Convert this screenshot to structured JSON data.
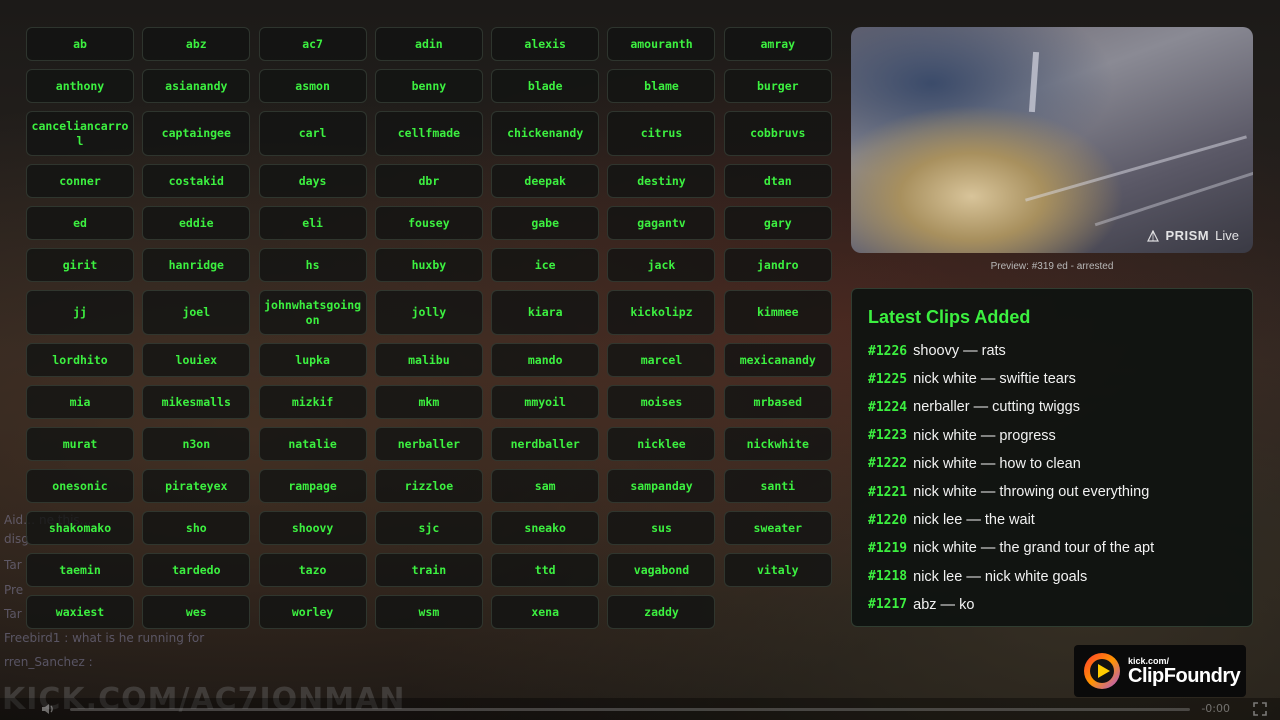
{
  "background_stream": {
    "chat_lines": [
      "Aid…          ne                    this…",
      "disg",
      "Tar",
      "Pre",
      "Tar",
      "Freebird1 : what is he running for",
      "rren_Sanchez :"
    ],
    "brand_text": "KICK.COM/AC7IONMAN",
    "time_label": "-0:00"
  },
  "streamers": [
    "ab",
    "abz",
    "ac7",
    "adin",
    "alexis",
    "amouranth",
    "amray",
    "anthony",
    "asianandy",
    "asmon",
    "benny",
    "blade",
    "blame",
    "burger",
    "canceliancarrol",
    "captaingee",
    "carl",
    "cellfmade",
    "chickenandy",
    "citrus",
    "cobbruvs",
    "conner",
    "costakid",
    "days",
    "dbr",
    "deepak",
    "destiny",
    "dtan",
    "ed",
    "eddie",
    "eli",
    "fousey",
    "gabe",
    "gagantv",
    "gary",
    "girit",
    "hanridge",
    "hs",
    "huxby",
    "ice",
    "jack",
    "jandro",
    "jj",
    "joel",
    "johnwhatsgoingon",
    "jolly",
    "kiara",
    "kickolipz",
    "kimmee",
    "lordhito",
    "louiex",
    "lupka",
    "malibu",
    "mando",
    "marcel",
    "mexicanandy",
    "mia",
    "mikesmalls",
    "mizkif",
    "mkm",
    "mmyoil",
    "moises",
    "mrbased",
    "murat",
    "n3on",
    "natalie",
    "nerballer",
    "nerdballer",
    "nicklee",
    "nickwhite",
    "onesonic",
    "pirateyex",
    "rampage",
    "rizzloe",
    "sam",
    "sampanday",
    "santi",
    "shakomako",
    "sho",
    "shoovy",
    "sjc",
    "sneako",
    "sus",
    "sweater",
    "taemin",
    "tardedo",
    "tazo",
    "train",
    "ttd",
    "vagabond",
    "vitaly",
    "waxiest",
    "wes",
    "worley",
    "wsm",
    "xena",
    "zaddy"
  ],
  "preview": {
    "watermark_brand": "PRISM",
    "watermark_suffix": "Live",
    "caption": "Preview: #319 ed - arrested"
  },
  "clips_panel": {
    "title": "Latest Clips Added",
    "items": [
      {
        "num": "#1226",
        "text": "shoovy — rats"
      },
      {
        "num": "#1225",
        "text": "nick white — swiftie tears"
      },
      {
        "num": "#1224",
        "text": "nerballer — cutting twiggs"
      },
      {
        "num": "#1223",
        "text": "nick white — progress"
      },
      {
        "num": "#1222",
        "text": "nick white — how to clean"
      },
      {
        "num": "#1221",
        "text": "nick white — throwing out everything"
      },
      {
        "num": "#1220",
        "text": "nick lee — the wait"
      },
      {
        "num": "#1219",
        "text": "nick white — the grand tour of the apt"
      },
      {
        "num": "#1218",
        "text": "nick lee — nick white goals"
      },
      {
        "num": "#1217",
        "text": "abz — ko"
      }
    ]
  },
  "logo": {
    "small_text": "kick.com/",
    "big_text": "ClipFoundry"
  },
  "colors": {
    "accent_green": "#3cf040",
    "tile_bg": "#121412",
    "panel_bg": "#0e1210"
  }
}
